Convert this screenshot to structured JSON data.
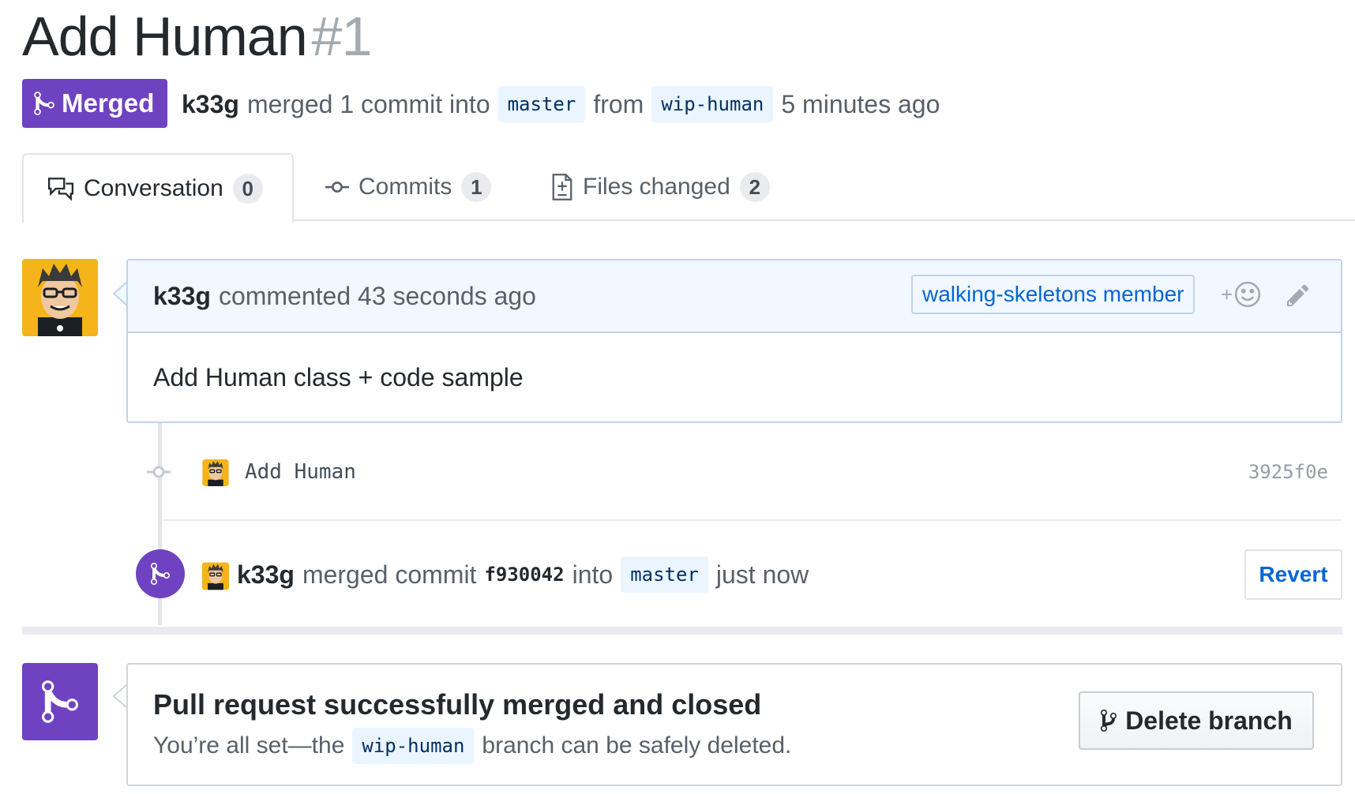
{
  "pr": {
    "title": "Add Human",
    "number": "#1",
    "state_label": "Merged",
    "author": "k33g",
    "merge_text": "merged 1 commit into",
    "base_branch": "master",
    "from_text": "from",
    "head_branch": "wip-human",
    "time": "5 minutes ago"
  },
  "tabs": [
    {
      "label": "Conversation",
      "count": "0",
      "icon": "comment-discussion-icon"
    },
    {
      "label": "Commits",
      "count": "1",
      "icon": "git-commit-icon"
    },
    {
      "label": "Files changed",
      "count": "2",
      "icon": "file-diff-icon"
    }
  ],
  "comment": {
    "author": "k33g",
    "action": "commented 43 seconds ago",
    "role": "walking-skeletons member",
    "reaction_plus": "+",
    "body": "Add Human class + code sample"
  },
  "commit": {
    "message": "Add Human",
    "sha": "3925f0e"
  },
  "merge_event": {
    "author": "k33g",
    "text": "merged commit",
    "sha": "f930042",
    "into_text": "into",
    "branch": "master",
    "time": "just now",
    "revert_label": "Revert"
  },
  "merged_box": {
    "title": "Pull request successfully merged and closed",
    "sub_before": "You’re all set—the",
    "branch": "wip-human",
    "sub_after": "branch can be safely deleted.",
    "delete_label": "Delete branch"
  },
  "colors": {
    "merged_purple": "#6f42c1",
    "link_blue": "#0366d6",
    "branch_bg": "#eaf5ff"
  }
}
